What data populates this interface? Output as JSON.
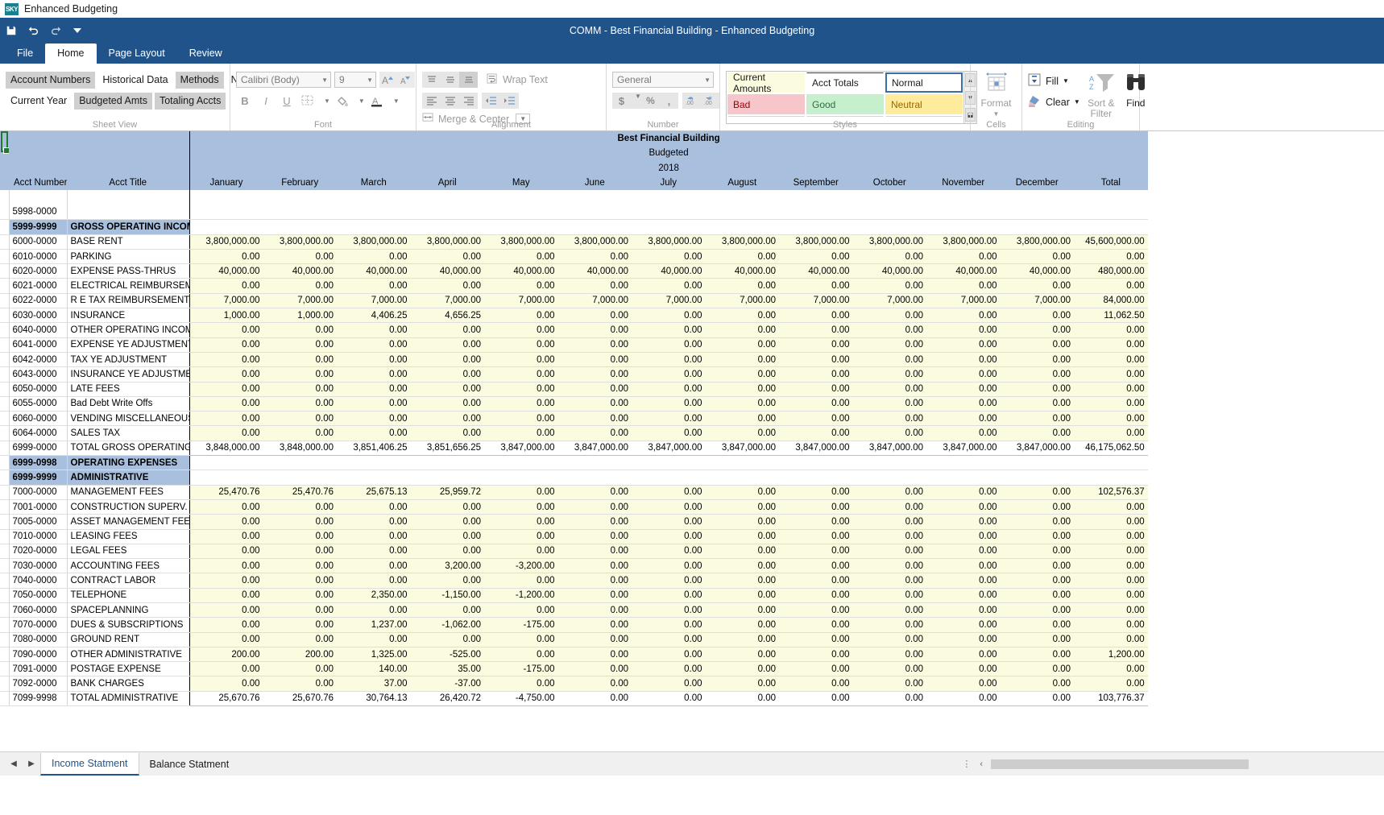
{
  "titlebar": {
    "logo": "SKY",
    "text": "Enhanced Budgeting"
  },
  "window": {
    "title": "COMM - Best Financial Building - Enhanced Budgeting"
  },
  "qat": [
    {
      "name": "save-icon",
      "label": "Save"
    },
    {
      "name": "undo-icon",
      "label": "Undo"
    },
    {
      "name": "redo-icon",
      "label": "Redo"
    },
    {
      "name": "customize-quick-access-icon",
      "label": "Customize"
    }
  ],
  "tabs": [
    {
      "label": "File",
      "active": false
    },
    {
      "label": "Home",
      "active": true
    },
    {
      "label": "Page Layout",
      "active": false
    },
    {
      "label": "Review",
      "active": false
    }
  ],
  "ribbon": {
    "sheet_view": {
      "label": "Sheet View",
      "row1": [
        {
          "label": "Account Numbers",
          "on": true
        },
        {
          "label": "Historical Data",
          "on": false
        },
        {
          "label": "Methods",
          "on": true
        },
        {
          "label": "Notes",
          "on": false
        }
      ],
      "row2": [
        {
          "label": "Current Year",
          "on": false
        },
        {
          "label": "Budgeted Amts",
          "on": true
        },
        {
          "label": "Totaling Accts",
          "on": true
        }
      ]
    },
    "font": {
      "label": "Font",
      "family": "Calibri (Body)",
      "size": "9",
      "grow_label": "A",
      "shrink_label": "A",
      "bold": "B",
      "italic": "I",
      "underline": "U"
    },
    "alignment": {
      "label": "Alignment",
      "wrap_text": "Wrap Text",
      "merge_center": "Merge & Center"
    },
    "number": {
      "label": "Number",
      "format": "General",
      "currency": "$",
      "percent": "%",
      "comma": ",",
      "inc_dec": ".00",
      "dec_dec": ".00"
    },
    "styles": {
      "label": "Styles",
      "cells": [
        {
          "label": "Current Amounts",
          "bg": "#fbfbe0",
          "fg": "#1a1a1a",
          "selected": false
        },
        {
          "label": "Acct Totals",
          "bg": "#ffffff",
          "fg": "#1a1a1a",
          "selected": false
        },
        {
          "label": "Normal",
          "bg": "#ffffff",
          "fg": "#1a1a1a",
          "selected": true
        },
        {
          "label": "Bad",
          "bg": "#f6c6ca",
          "fg": "#9c0006",
          "selected": false
        },
        {
          "label": "Good",
          "bg": "#c6efce",
          "fg": "#2f6f3e",
          "selected": false
        },
        {
          "label": "Neutral",
          "bg": "#ffeb9c",
          "fg": "#9c6500",
          "selected": false
        }
      ]
    },
    "cells": {
      "label": "Cells",
      "format": "Format"
    },
    "editing": {
      "label": "Editing",
      "fill": "Fill",
      "clear": "Clear",
      "sort_filter": "Sort &\nFilter",
      "sort_filter_l1": "Sort &",
      "sort_filter_l2": "Filter",
      "find": "Find"
    }
  },
  "sheet": {
    "title": "Best Financial Building",
    "subtitle": "Budgeted",
    "year": "2018",
    "columns": [
      "Acct Number",
      "Acct Title",
      "January",
      "February",
      "March",
      "April",
      "May",
      "June",
      "July",
      "August",
      "September",
      "October",
      "November",
      "December",
      "Total"
    ],
    "rows": [
      {
        "type": "blank",
        "acct": "",
        "title": "",
        "values": [
          "",
          "",
          "",
          "",
          "",
          "",
          "",
          "",
          "",
          "",
          "",
          "",
          ""
        ]
      },
      {
        "type": "data-plain",
        "acct": "5998-0000",
        "title": "",
        "values": [
          "",
          "",
          "",
          "",
          "",
          "",
          "",
          "",
          "",
          "",
          "",
          "",
          ""
        ]
      },
      {
        "type": "group",
        "acct": "5999-9999",
        "title": "GROSS OPERATING INCOME",
        "values": [
          "",
          "",
          "",
          "",
          "",
          "",
          "",
          "",
          "",
          "",
          "",
          "",
          ""
        ]
      },
      {
        "type": "data",
        "acct": "6000-0000",
        "title": "BASE RENT",
        "values": [
          "3,800,000.00",
          "3,800,000.00",
          "3,800,000.00",
          "3,800,000.00",
          "3,800,000.00",
          "3,800,000.00",
          "3,800,000.00",
          "3,800,000.00",
          "3,800,000.00",
          "3,800,000.00",
          "3,800,000.00",
          "3,800,000.00",
          "45,600,000.00"
        ]
      },
      {
        "type": "data",
        "acct": "6010-0000",
        "title": "PARKING",
        "values": [
          "0.00",
          "0.00",
          "0.00",
          "0.00",
          "0.00",
          "0.00",
          "0.00",
          "0.00",
          "0.00",
          "0.00",
          "0.00",
          "0.00",
          "0.00"
        ]
      },
      {
        "type": "data",
        "acct": "6020-0000",
        "title": "EXPENSE PASS-THRUS",
        "values": [
          "40,000.00",
          "40,000.00",
          "40,000.00",
          "40,000.00",
          "40,000.00",
          "40,000.00",
          "40,000.00",
          "40,000.00",
          "40,000.00",
          "40,000.00",
          "40,000.00",
          "40,000.00",
          "480,000.00"
        ]
      },
      {
        "type": "data",
        "acct": "6021-0000",
        "title": "ELECTRICAL REIMBURSEMENT",
        "values": [
          "0.00",
          "0.00",
          "0.00",
          "0.00",
          "0.00",
          "0.00",
          "0.00",
          "0.00",
          "0.00",
          "0.00",
          "0.00",
          "0.00",
          "0.00"
        ]
      },
      {
        "type": "data",
        "acct": "6022-0000",
        "title": "R E TAX REIMBURSEMENT",
        "values": [
          "7,000.00",
          "7,000.00",
          "7,000.00",
          "7,000.00",
          "7,000.00",
          "7,000.00",
          "7,000.00",
          "7,000.00",
          "7,000.00",
          "7,000.00",
          "7,000.00",
          "7,000.00",
          "84,000.00"
        ]
      },
      {
        "type": "data",
        "acct": "6030-0000",
        "title": "INSURANCE",
        "values": [
          "1,000.00",
          "1,000.00",
          "4,406.25",
          "4,656.25",
          "0.00",
          "0.00",
          "0.00",
          "0.00",
          "0.00",
          "0.00",
          "0.00",
          "0.00",
          "11,062.50"
        ]
      },
      {
        "type": "data",
        "acct": "6040-0000",
        "title": "OTHER OPERATING INCOME",
        "values": [
          "0.00",
          "0.00",
          "0.00",
          "0.00",
          "0.00",
          "0.00",
          "0.00",
          "0.00",
          "0.00",
          "0.00",
          "0.00",
          "0.00",
          "0.00"
        ]
      },
      {
        "type": "data",
        "acct": "6041-0000",
        "title": "EXPENSE YE ADJUSTMENT",
        "values": [
          "0.00",
          "0.00",
          "0.00",
          "0.00",
          "0.00",
          "0.00",
          "0.00",
          "0.00",
          "0.00",
          "0.00",
          "0.00",
          "0.00",
          "0.00"
        ]
      },
      {
        "type": "data",
        "acct": "6042-0000",
        "title": "TAX YE ADJUSTMENT",
        "values": [
          "0.00",
          "0.00",
          "0.00",
          "0.00",
          "0.00",
          "0.00",
          "0.00",
          "0.00",
          "0.00",
          "0.00",
          "0.00",
          "0.00",
          "0.00"
        ]
      },
      {
        "type": "data",
        "acct": "6043-0000",
        "title": "INSURANCE YE ADJUSTMENT",
        "values": [
          "0.00",
          "0.00",
          "0.00",
          "0.00",
          "0.00",
          "0.00",
          "0.00",
          "0.00",
          "0.00",
          "0.00",
          "0.00",
          "0.00",
          "0.00"
        ]
      },
      {
        "type": "data",
        "acct": "6050-0000",
        "title": "LATE FEES",
        "values": [
          "0.00",
          "0.00",
          "0.00",
          "0.00",
          "0.00",
          "0.00",
          "0.00",
          "0.00",
          "0.00",
          "0.00",
          "0.00",
          "0.00",
          "0.00"
        ]
      },
      {
        "type": "data",
        "acct": "6055-0000",
        "title": "Bad Debt Write Offs",
        "values": [
          "0.00",
          "0.00",
          "0.00",
          "0.00",
          "0.00",
          "0.00",
          "0.00",
          "0.00",
          "0.00",
          "0.00",
          "0.00",
          "0.00",
          "0.00"
        ]
      },
      {
        "type": "data",
        "acct": "6060-0000",
        "title": "VENDING MISCELLANEOUS",
        "values": [
          "0.00",
          "0.00",
          "0.00",
          "0.00",
          "0.00",
          "0.00",
          "0.00",
          "0.00",
          "0.00",
          "0.00",
          "0.00",
          "0.00",
          "0.00"
        ]
      },
      {
        "type": "data",
        "acct": "6064-0000",
        "title": "SALES TAX",
        "values": [
          "0.00",
          "0.00",
          "0.00",
          "0.00",
          "0.00",
          "0.00",
          "0.00",
          "0.00",
          "0.00",
          "0.00",
          "0.00",
          "0.00",
          "0.00"
        ]
      },
      {
        "type": "total",
        "acct": "6999-0000",
        "title": "TOTAL GROSS OPERATING INC",
        "values": [
          "3,848,000.00",
          "3,848,000.00",
          "3,851,406.25",
          "3,851,656.25",
          "3,847,000.00",
          "3,847,000.00",
          "3,847,000.00",
          "3,847,000.00",
          "3,847,000.00",
          "3,847,000.00",
          "3,847,000.00",
          "3,847,000.00",
          "46,175,062.50"
        ]
      },
      {
        "type": "group",
        "acct": "6999-0998",
        "title": "OPERATING EXPENSES",
        "values": [
          "",
          "",
          "",
          "",
          "",
          "",
          "",
          "",
          "",
          "",
          "",
          "",
          ""
        ]
      },
      {
        "type": "group",
        "acct": "6999-9999",
        "title": "ADMINISTRATIVE",
        "values": [
          "",
          "",
          "",
          "",
          "",
          "",
          "",
          "",
          "",
          "",
          "",
          "",
          ""
        ]
      },
      {
        "type": "data",
        "acct": "7000-0000",
        "title": "MANAGEMENT FEES",
        "values": [
          "25,470.76",
          "25,470.76",
          "25,675.13",
          "25,959.72",
          "0.00",
          "0.00",
          "0.00",
          "0.00",
          "0.00",
          "0.00",
          "0.00",
          "0.00",
          "102,576.37"
        ]
      },
      {
        "type": "data",
        "acct": "7001-0000",
        "title": "CONSTRUCTION SUPERV. FEES",
        "values": [
          "0.00",
          "0.00",
          "0.00",
          "0.00",
          "0.00",
          "0.00",
          "0.00",
          "0.00",
          "0.00",
          "0.00",
          "0.00",
          "0.00",
          "0.00"
        ]
      },
      {
        "type": "data",
        "acct": "7005-0000",
        "title": "ASSET MANAGEMENT FEES",
        "values": [
          "0.00",
          "0.00",
          "0.00",
          "0.00",
          "0.00",
          "0.00",
          "0.00",
          "0.00",
          "0.00",
          "0.00",
          "0.00",
          "0.00",
          "0.00"
        ]
      },
      {
        "type": "data",
        "acct": "7010-0000",
        "title": "LEASING FEES",
        "values": [
          "0.00",
          "0.00",
          "0.00",
          "0.00",
          "0.00",
          "0.00",
          "0.00",
          "0.00",
          "0.00",
          "0.00",
          "0.00",
          "0.00",
          "0.00"
        ]
      },
      {
        "type": "data",
        "acct": "7020-0000",
        "title": "LEGAL FEES",
        "values": [
          "0.00",
          "0.00",
          "0.00",
          "0.00",
          "0.00",
          "0.00",
          "0.00",
          "0.00",
          "0.00",
          "0.00",
          "0.00",
          "0.00",
          "0.00"
        ]
      },
      {
        "type": "data",
        "acct": "7030-0000",
        "title": "ACCOUNTING FEES",
        "values": [
          "0.00",
          "0.00",
          "0.00",
          "3,200.00",
          "-3,200.00",
          "0.00",
          "0.00",
          "0.00",
          "0.00",
          "0.00",
          "0.00",
          "0.00",
          "0.00"
        ]
      },
      {
        "type": "data",
        "acct": "7040-0000",
        "title": "CONTRACT LABOR",
        "values": [
          "0.00",
          "0.00",
          "0.00",
          "0.00",
          "0.00",
          "0.00",
          "0.00",
          "0.00",
          "0.00",
          "0.00",
          "0.00",
          "0.00",
          "0.00"
        ]
      },
      {
        "type": "data",
        "acct": "7050-0000",
        "title": "TELEPHONE",
        "values": [
          "0.00",
          "0.00",
          "2,350.00",
          "-1,150.00",
          "-1,200.00",
          "0.00",
          "0.00",
          "0.00",
          "0.00",
          "0.00",
          "0.00",
          "0.00",
          "0.00"
        ]
      },
      {
        "type": "data",
        "acct": "7060-0000",
        "title": "SPACEPLANNING",
        "values": [
          "0.00",
          "0.00",
          "0.00",
          "0.00",
          "0.00",
          "0.00",
          "0.00",
          "0.00",
          "0.00",
          "0.00",
          "0.00",
          "0.00",
          "0.00"
        ]
      },
      {
        "type": "data",
        "acct": "7070-0000",
        "title": "DUES & SUBSCRIPTIONS",
        "values": [
          "0.00",
          "0.00",
          "1,237.00",
          "-1,062.00",
          "-175.00",
          "0.00",
          "0.00",
          "0.00",
          "0.00",
          "0.00",
          "0.00",
          "0.00",
          "0.00"
        ]
      },
      {
        "type": "data",
        "acct": "7080-0000",
        "title": "GROUND RENT",
        "values": [
          "0.00",
          "0.00",
          "0.00",
          "0.00",
          "0.00",
          "0.00",
          "0.00",
          "0.00",
          "0.00",
          "0.00",
          "0.00",
          "0.00",
          "0.00"
        ]
      },
      {
        "type": "data",
        "acct": "7090-0000",
        "title": "OTHER ADMINISTRATIVE",
        "values": [
          "200.00",
          "200.00",
          "1,325.00",
          "-525.00",
          "0.00",
          "0.00",
          "0.00",
          "0.00",
          "0.00",
          "0.00",
          "0.00",
          "0.00",
          "1,200.00"
        ]
      },
      {
        "type": "data",
        "acct": "7091-0000",
        "title": "POSTAGE EXPENSE",
        "values": [
          "0.00",
          "0.00",
          "140.00",
          "35.00",
          "-175.00",
          "0.00",
          "0.00",
          "0.00",
          "0.00",
          "0.00",
          "0.00",
          "0.00",
          "0.00"
        ]
      },
      {
        "type": "data",
        "acct": "7092-0000",
        "title": "BANK CHARGES",
        "values": [
          "0.00",
          "0.00",
          "37.00",
          "-37.00",
          "0.00",
          "0.00",
          "0.00",
          "0.00",
          "0.00",
          "0.00",
          "0.00",
          "0.00",
          "0.00"
        ]
      },
      {
        "type": "total",
        "acct": "7099-9998",
        "title": "TOTAL ADMINISTRATIVE",
        "values": [
          "25,670.76",
          "25,670.76",
          "30,764.13",
          "26,420.72",
          "-4,750.00",
          "0.00",
          "0.00",
          "0.00",
          "0.00",
          "0.00",
          "0.00",
          "0.00",
          "103,776.37"
        ]
      }
    ]
  },
  "sheet_tabs": {
    "prev_label": "◀",
    "next_label": "▶",
    "tabs": [
      {
        "label": "Income Statment",
        "active": true
      },
      {
        "label": "Balance Statment",
        "active": false
      }
    ]
  }
}
